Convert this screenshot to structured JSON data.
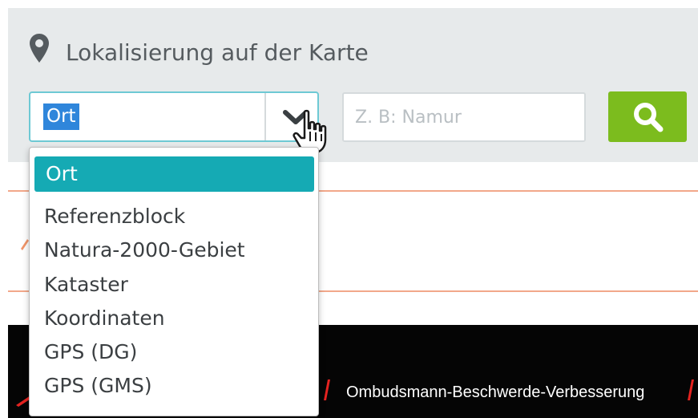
{
  "section": {
    "title": "Lokalisierung auf der Karte"
  },
  "locator": {
    "selected_value": "Ort",
    "search_placeholder": "Z. B: Namur",
    "options": [
      "Ort",
      "Referenzblock",
      "Natura-2000-Gebiet",
      "Kataster",
      "Koordinaten",
      "GPS (DG)",
      "GPS (GMS)"
    ]
  },
  "footer": {
    "link_text": "Ombudsmann-Beschwerde-Verbesserung"
  },
  "colors": {
    "panel_bg": "#e7eaeb",
    "select_border": "#6ec9d4",
    "text_highlight": "#2f86db",
    "option_selected": "#15aab4",
    "search_button": "#7cbc1e",
    "divider_line": "#f2a88a",
    "footer_bg": "#050505",
    "footer_accent": "#e52320"
  },
  "icons": {
    "title": "map-pin-icon",
    "select_toggle": "chevron-down-icon",
    "cursor": "hand-pointer-icon",
    "search": "search-icon"
  }
}
